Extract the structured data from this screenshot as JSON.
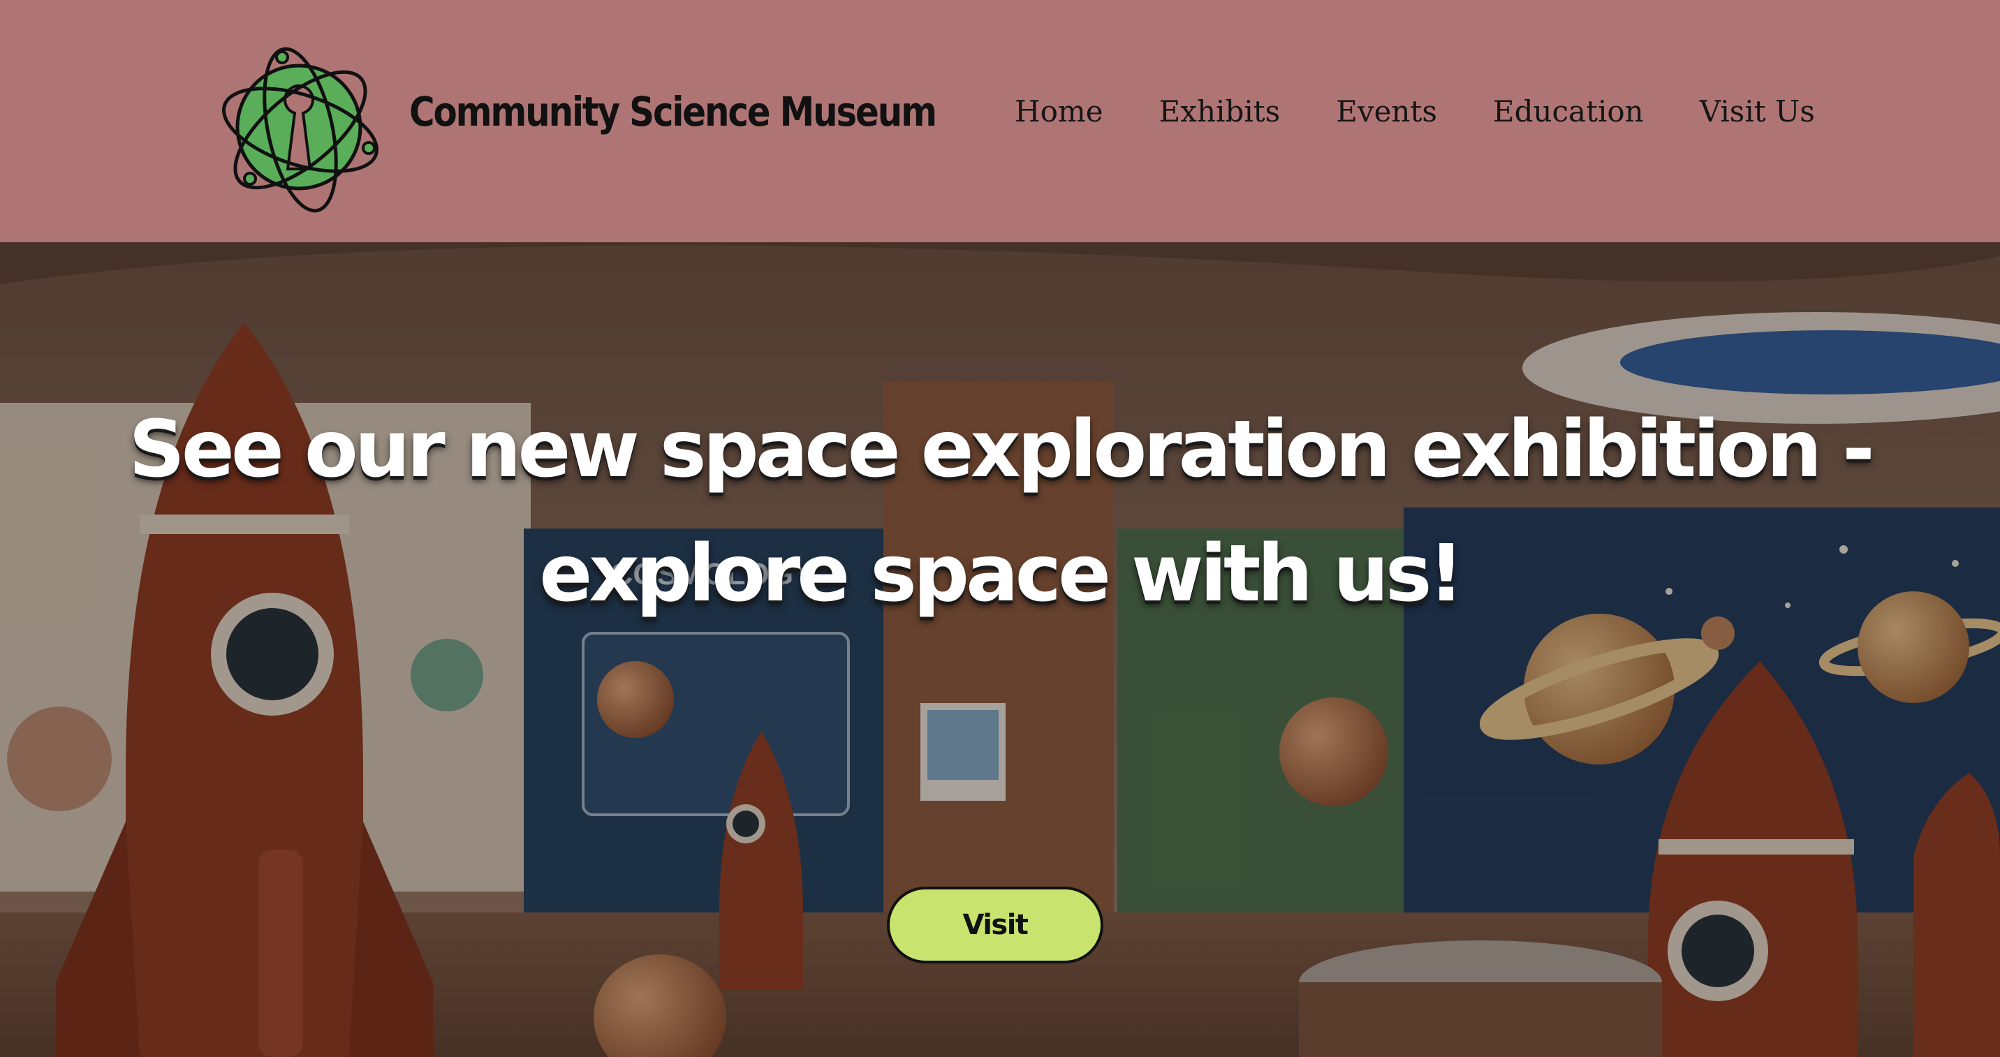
{
  "header": {
    "brand_name": "Community Science Museum",
    "logo_icon": "atom-keyhole-logo-icon",
    "nav": [
      {
        "label": "Home"
      },
      {
        "label": "Exhibits"
      },
      {
        "label": "Events"
      },
      {
        "label": "Education"
      },
      {
        "label": "Visit Us"
      }
    ]
  },
  "hero": {
    "headline": "See our new space exploration exhibition - explore space with us!",
    "cta_label": "Visit",
    "background_image": "space exhibition hall with rockets and planets",
    "exhibit_sign_text": "COSMOLOGY"
  },
  "colors": {
    "header_bg": "#af7574",
    "cta_bg": "#c8e46e",
    "logo_green": "#5aae5a",
    "text_dark": "#111111"
  }
}
